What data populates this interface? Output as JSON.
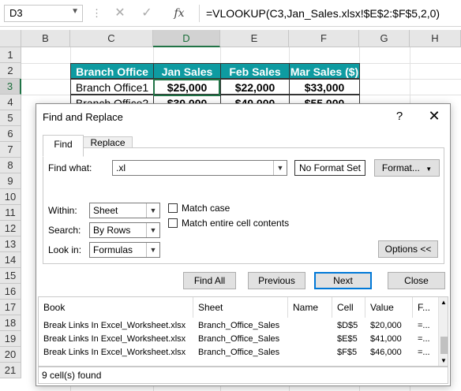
{
  "formula_bar": {
    "name_box": "D3",
    "fx_label": "fx",
    "formula": "=VLOOKUP(C3,Jan_Sales.xlsx!$E$2:$F$5,2,0)"
  },
  "columns": [
    "B",
    "C",
    "D",
    "E",
    "F",
    "G",
    "H"
  ],
  "rows": [
    "1",
    "2",
    "3",
    "4",
    "5",
    "6",
    "7",
    "8",
    "9",
    "10",
    "11",
    "12",
    "13",
    "14",
    "15",
    "16",
    "17",
    "18",
    "19",
    "20",
    "21"
  ],
  "sheet": {
    "headers": [
      "Branch Office",
      "Jan Sales ($)",
      "Feb Sales ($)",
      "Mar Sales ($)"
    ],
    "row3": [
      "Branch Office1",
      "$25,000",
      "$22,000",
      "$33,000"
    ],
    "row4": [
      "Branch Office2",
      "$30,000",
      "$40,000",
      "$55,000"
    ]
  },
  "dialog": {
    "title": "Find and Replace",
    "help": "?",
    "close": "✕",
    "tabs": {
      "find": "Find",
      "replace": "Replace"
    },
    "find_what_label": "Find what:",
    "find_what_value": ".xl",
    "no_format_set": "No Format Set",
    "format_button": "Format...",
    "within_label": "Within:",
    "within_value": "Sheet",
    "search_label": "Search:",
    "search_value": "By Rows",
    "look_in_label": "Look in:",
    "look_in_value": "Formulas",
    "match_case_label": "Match case",
    "match_entire_label": "Match entire cell contents",
    "options_button": "Options <<",
    "buttons": {
      "find_all": "Find All",
      "previous": "Previous",
      "next": "Next",
      "close": "Close"
    },
    "results": {
      "headers": [
        "Book",
        "Sheet",
        "Name",
        "Cell",
        "Value",
        "F..."
      ],
      "rows": [
        [
          "Break Links In Excel_Worksheet.xlsx",
          "Branch_Office_Sales",
          "",
          "$D$5",
          "$20,000",
          "=..."
        ],
        [
          "Break Links In Excel_Worksheet.xlsx",
          "Branch_Office_Sales",
          "",
          "$E$5",
          "$41,000",
          "=..."
        ],
        [
          "Break Links In Excel_Worksheet.xlsx",
          "Branch_Office_Sales",
          "",
          "$F$5",
          "$46,000",
          "=..."
        ]
      ]
    },
    "status": "9 cell(s) found"
  }
}
